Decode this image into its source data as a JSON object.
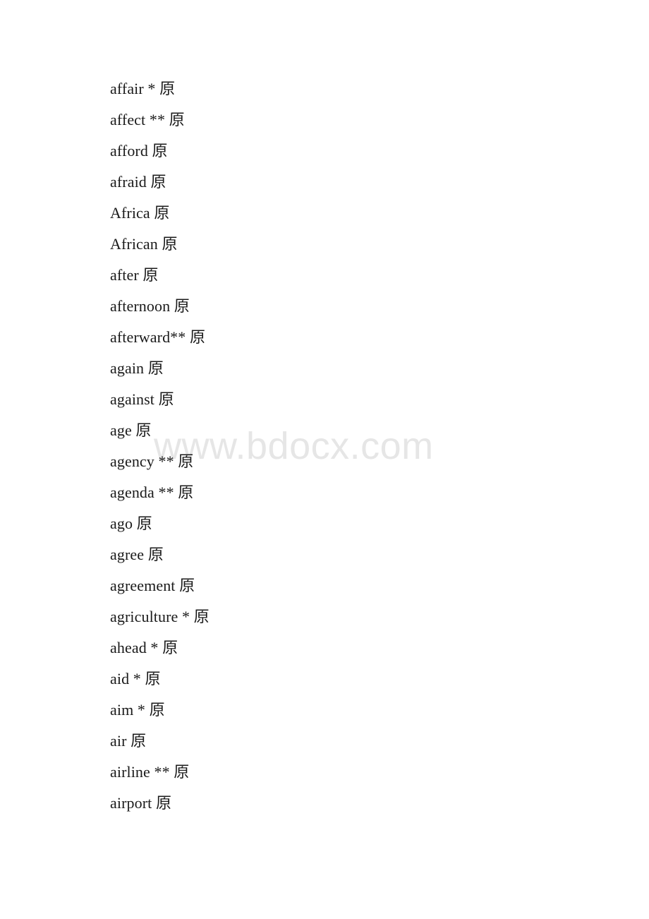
{
  "document": {
    "type": "vocabulary-word-list",
    "background_color": "#ffffff",
    "text_color": "#1a1a1a"
  },
  "watermark": {
    "text": "www.bdocx.com",
    "color": "#e6e6e6"
  },
  "word_list": {
    "entries": [
      {
        "text": "affair * 原"
      },
      {
        "text": "affect ** 原"
      },
      {
        "text": "afford 原"
      },
      {
        "text": "afraid 原"
      },
      {
        "text": "Africa 原"
      },
      {
        "text": "African 原"
      },
      {
        "text": "after 原"
      },
      {
        "text": "afternoon 原"
      },
      {
        "text": "afterward** 原"
      },
      {
        "text": "again 原"
      },
      {
        "text": "against 原"
      },
      {
        "text": "age 原"
      },
      {
        "text": "agency ** 原"
      },
      {
        "text": "agenda ** 原"
      },
      {
        "text": "ago 原"
      },
      {
        "text": "agree 原"
      },
      {
        "text": "agreement 原"
      },
      {
        "text": "agriculture * 原"
      },
      {
        "text": "ahead * 原"
      },
      {
        "text": "aid * 原"
      },
      {
        "text": "aim * 原"
      },
      {
        "text": "air 原"
      },
      {
        "text": "airline ** 原"
      },
      {
        "text": "airport 原"
      }
    ]
  }
}
